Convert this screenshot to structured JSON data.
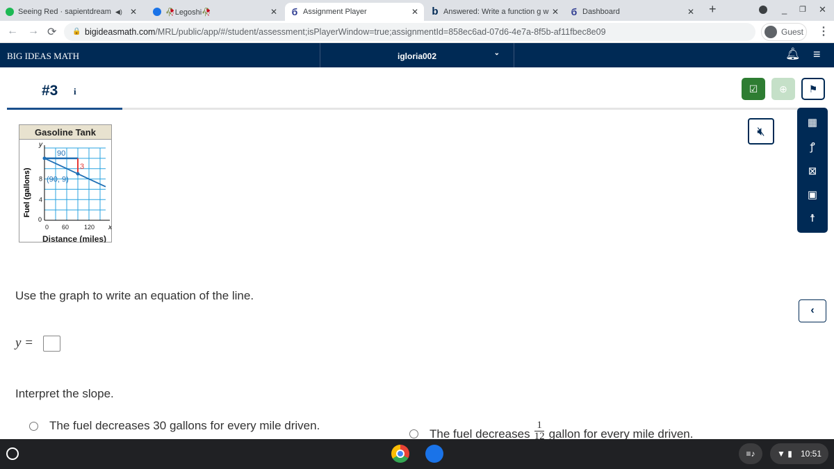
{
  "browser": {
    "tabs": [
      {
        "label": "Seeing Red · sapientdream",
        "icon": "spotify-icon",
        "color": "#1db954",
        "audio": true
      },
      {
        "label": "🥀Legoshi🥀",
        "icon": "app-icon",
        "color": "#1a73e8"
      },
      {
        "label": "Assignment Player",
        "icon": "big-ideas-icon",
        "color": "#2b3990",
        "active": true
      },
      {
        "label": "Answered: Write a function g w",
        "icon": "bartleby-icon",
        "color": "#002a55"
      },
      {
        "label": "Dashboard",
        "icon": "big-ideas-icon",
        "color": "#2b3990"
      }
    ],
    "new_tab": "+",
    "url_host": "bigideasmath.com",
    "url_path": "/MRL/public/app/#/student/assessment;isPlayerWindow=true;assignmentId=858ec6ad-07d6-4e7a-8f5b-af11fbec8e09",
    "profile": "Guest"
  },
  "header": {
    "brand": "BIG IDEAS MATH",
    "user": "igloria002",
    "bg": "#002a55"
  },
  "question": {
    "number": "#3",
    "info": "i",
    "graph": {
      "title": "Gasoline Tank",
      "ylabel": "Fuel (gallons)",
      "xlabel": "Distance (miles)",
      "x_axis": "x",
      "y_axis": "y",
      "xticks": [
        "0",
        "60",
        "120"
      ],
      "yticks": [
        "4",
        "8"
      ],
      "origin": "0",
      "run_label": "90",
      "rise_label": "3",
      "point_label": "(90, 9)",
      "line": [
        [
          0,
          12
        ],
        [
          165,
          6.5
        ]
      ],
      "point": [
        90,
        9
      ],
      "xlim": [
        0,
        165
      ],
      "ylim": [
        0,
        14
      ]
    },
    "prompt": "Use the graph to write an equation of the line.",
    "answer_prefix": "y =",
    "answer_value": "",
    "interpret": "Interpret the slope.",
    "options": [
      {
        "text": "The fuel decreases 30 gallons for every mile driven."
      },
      {
        "pre": "The fuel decreases",
        "num": "1",
        "den": "12",
        "post": "gallon for every mile driven."
      }
    ]
  },
  "taskbar": {
    "time": "10:51"
  }
}
